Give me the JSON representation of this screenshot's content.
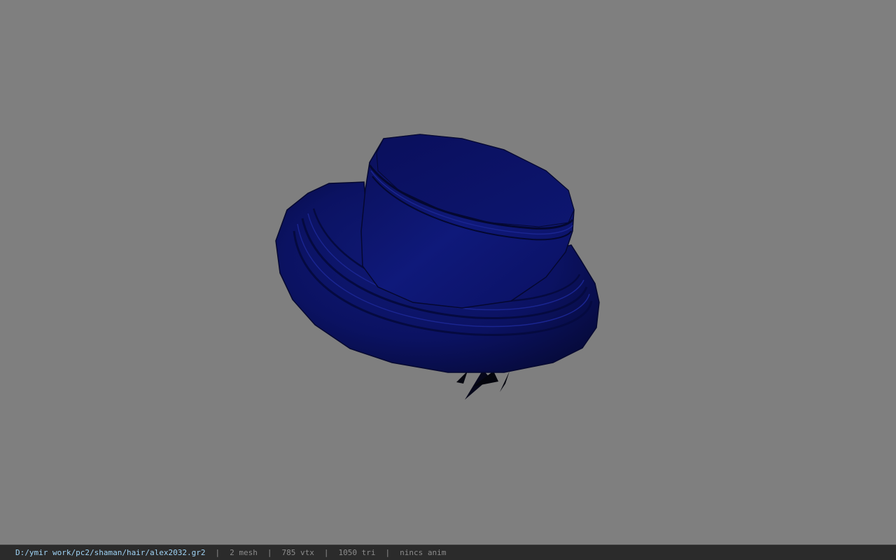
{
  "viewport": {
    "background_color": "#7f7f7f",
    "model": {
      "icon": "hat-model",
      "primary_color": "#0b0f5a"
    }
  },
  "statusbar": {
    "file_path": "D:/ymir work/pc2/shaman/hair/alex2032.gr2",
    "mesh_count": "2 mesh",
    "vertex_count": "785 vtx",
    "triangle_count": "1050 tri",
    "anim_status": "nincs anim",
    "path_color": "#9fd3f5",
    "text_color": "#8c8c8c"
  }
}
